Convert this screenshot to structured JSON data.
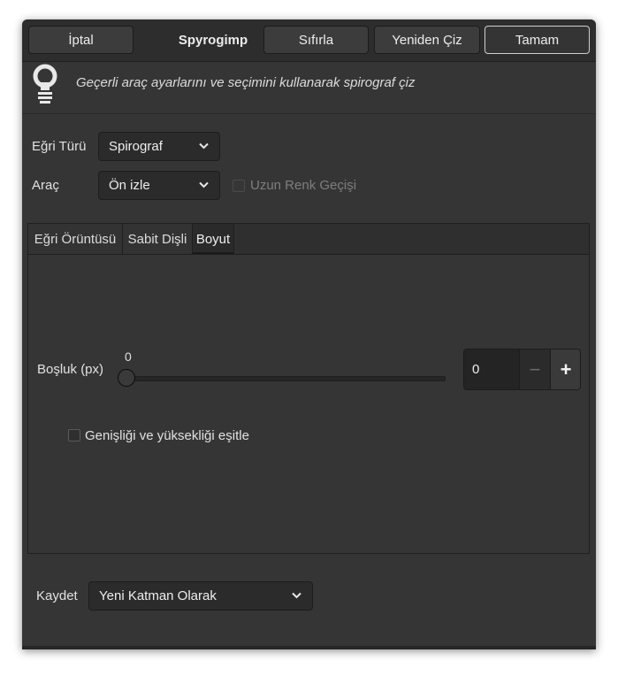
{
  "header": {
    "cancel_label": "İptal",
    "title": "Spyrogimp",
    "reset_label": "Sıfırla",
    "redraw_label": "Yeniden Çiz",
    "ok_label": "Tamam"
  },
  "info": {
    "icon": "lightbulb-icon",
    "text": "Geçerli araç ayarlarını ve seçimini kullanarak spirograf çiz"
  },
  "curve_type": {
    "label": "Eğri Türü",
    "value": "Spirograf"
  },
  "tool": {
    "label": "Araç",
    "value": "Ön izle"
  },
  "long_gradient": {
    "label": "Uzun Renk Geçişi",
    "checked": false,
    "enabled": false
  },
  "tabs": [
    {
      "label": "Eğri Örüntüsü",
      "active": false
    },
    {
      "label": "Sabit Dişli",
      "active": false
    },
    {
      "label": "Boyut",
      "active": true
    }
  ],
  "margin": {
    "label": "Boşluk (px)",
    "value_label": "0",
    "entry_value": "0",
    "minus": "−",
    "plus": "+"
  },
  "equal_size": {
    "label": "Genişliği ve yüksekliği eşitle",
    "checked": false
  },
  "save": {
    "label": "Kaydet",
    "value": "Yeni Katman Olarak"
  }
}
